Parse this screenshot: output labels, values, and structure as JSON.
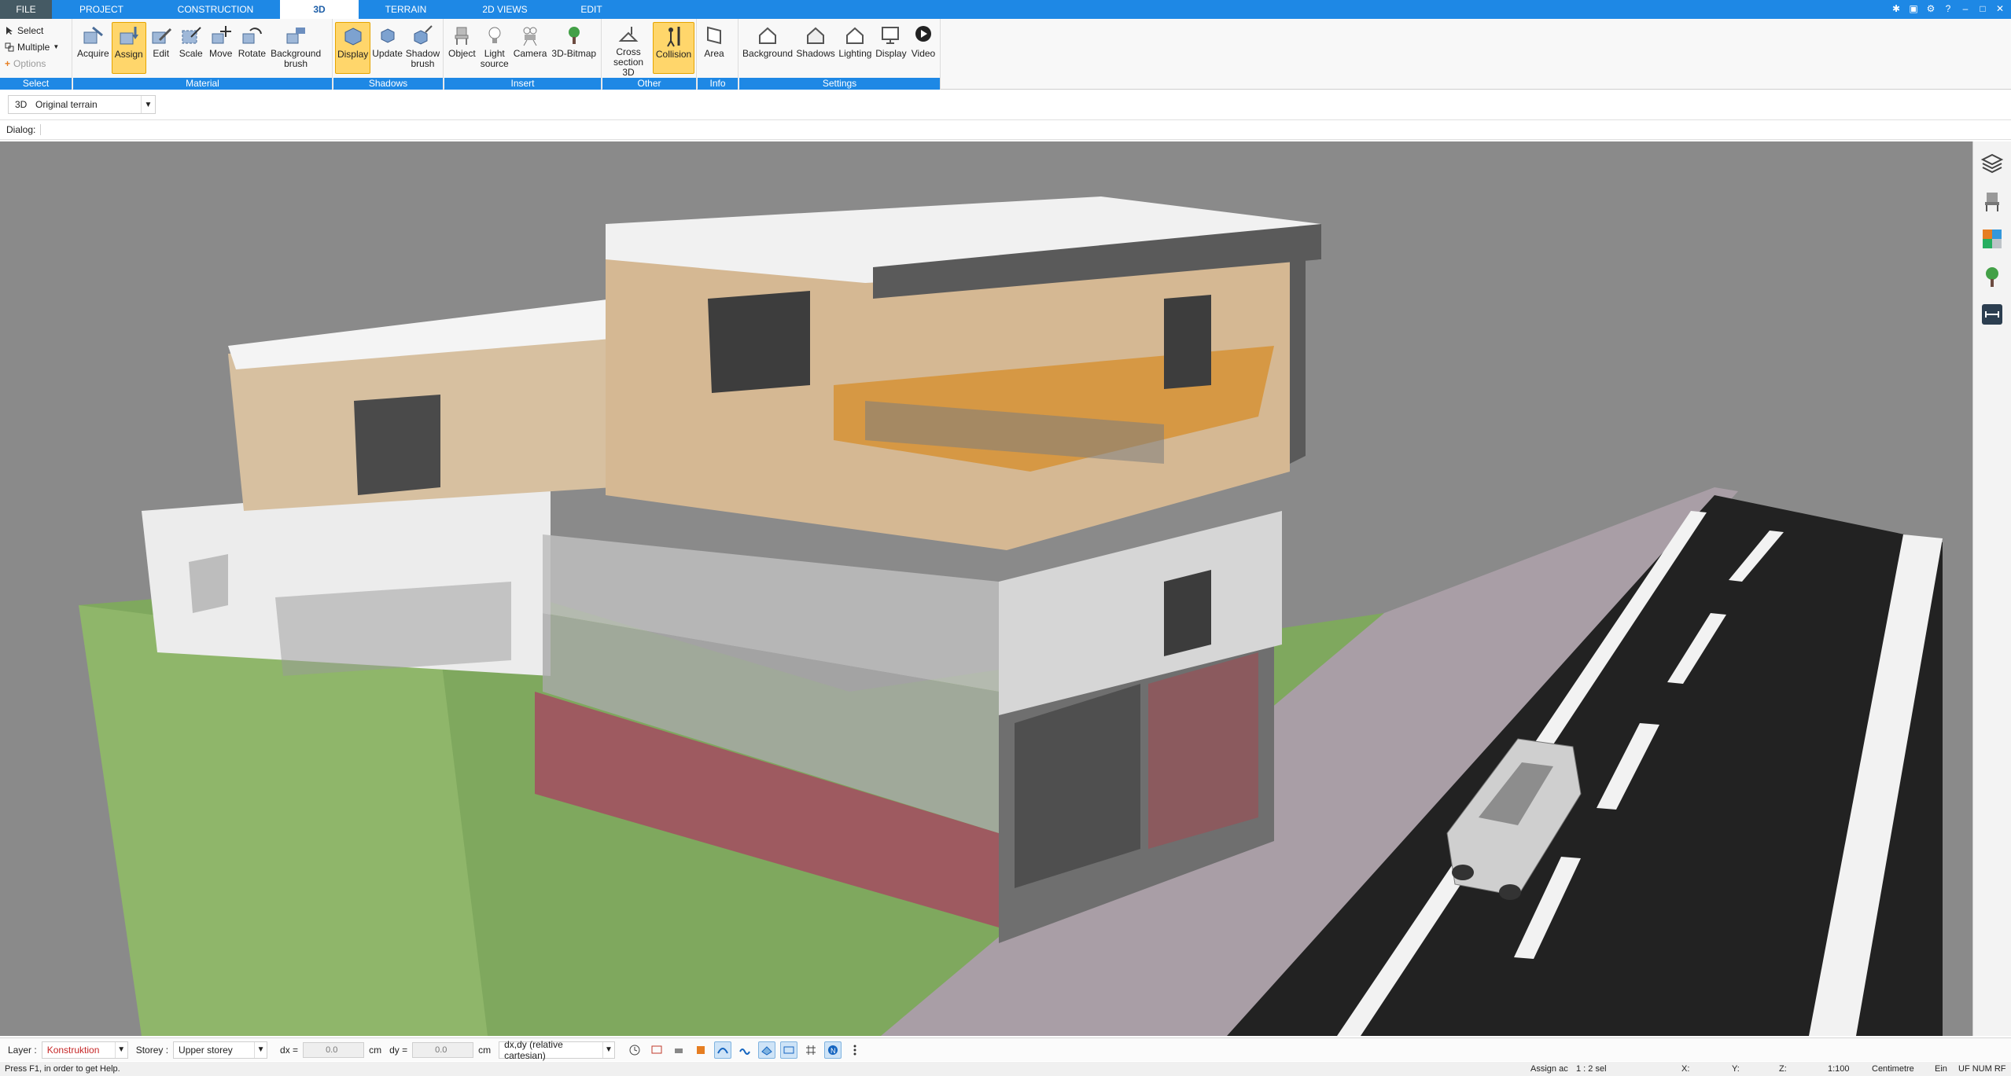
{
  "tabs": [
    {
      "label": "FILE"
    },
    {
      "label": "PROJECT"
    },
    {
      "label": "CONSTRUCTION"
    },
    {
      "label": "3D"
    },
    {
      "label": "TERRAIN"
    },
    {
      "label": "2D VIEWS"
    },
    {
      "label": "EDIT"
    }
  ],
  "ribbon": {
    "select_group": {
      "title": "Select",
      "select": "Select",
      "multiple": "Multiple",
      "options": "Options"
    },
    "material": {
      "title": "Material",
      "acquire": "Acquire",
      "assign": "Assign",
      "edit": "Edit",
      "scale": "Scale",
      "move": "Move",
      "rotate": "Rotate",
      "background_brush": "Background\nbrush"
    },
    "shadows": {
      "title": "Shadows",
      "display": "Display",
      "update": "Update",
      "shadow_brush": "Shadow\nbrush"
    },
    "insert": {
      "title": "Insert",
      "object": "Object",
      "light_source": "Light\nsource",
      "camera": "Camera",
      "bitmap": "3D-Bitmap"
    },
    "other": {
      "title": "Other",
      "cross_section": "Cross\nsection 3D",
      "collision": "Collision"
    },
    "info": {
      "title": "Info",
      "area": "Area"
    },
    "settings": {
      "title": "Settings",
      "background": "Background",
      "shadows": "Shadows",
      "lighting": "Lighting",
      "display": "Display",
      "video": "Video"
    }
  },
  "view_selector": {
    "mode": "3D",
    "value": "Original terrain"
  },
  "dialog_label": "Dialog:",
  "bottom": {
    "layer_label": "Layer :",
    "layer_value": "Konstruktion",
    "storey_label": "Storey :",
    "storey_value": "Upper storey",
    "dx_label": "dx =",
    "dx_value": "0.0",
    "dx_unit": "cm",
    "dy_label": "dy =",
    "dy_value": "0.0",
    "dy_unit": "cm",
    "coord_mode": "dx,dy (relative cartesian)"
  },
  "status": {
    "help": "Press F1, in order to get Help.",
    "assign": "Assign ac",
    "sel": "1 : 2 sel",
    "x": "X:",
    "y": "Y:",
    "z": "Z:",
    "scale": "1:100",
    "unit": "Centimetre",
    "ein": "Ein",
    "flags": "UF NUM RF"
  },
  "colors": {
    "accent": "#1e88e5",
    "active_button": "#ffd66b",
    "viewport_bg": "#8a8a8a",
    "layer_text": "#c62828"
  }
}
